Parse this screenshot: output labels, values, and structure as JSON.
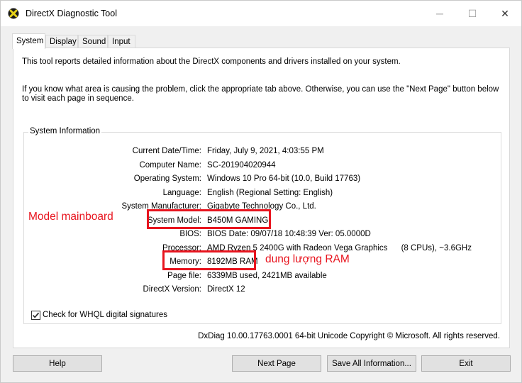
{
  "window": {
    "title": "DirectX Diagnostic Tool",
    "controls": {
      "minimize": "─",
      "maximize": "☐",
      "close": "✕"
    }
  },
  "tabs": [
    {
      "label": "System",
      "active": true
    },
    {
      "label": "Display",
      "active": false
    },
    {
      "label": "Sound",
      "active": false
    },
    {
      "label": "Input",
      "active": false
    }
  ],
  "intro": {
    "line1": "This tool reports detailed information about the DirectX components and drivers installed on your system.",
    "line2": "If you know what area is causing the problem, click the appropriate tab above.  Otherwise, you can use the \"Next Page\" button below to visit each page in sequence."
  },
  "system_info": {
    "title": "System Information",
    "rows": [
      {
        "label": "Current Date/Time:",
        "value": "Friday, July 9, 2021, 4:03:55 PM"
      },
      {
        "label": "Computer Name:",
        "value": "SC-201904020944"
      },
      {
        "label": "Operating System:",
        "value": "Windows 10 Pro 64-bit (10.0, Build 17763)"
      },
      {
        "label": "Language:",
        "value": "English (Regional Setting: English)"
      },
      {
        "label": "System Manufacturer:",
        "value": "Gigabyte Technology Co., Ltd."
      },
      {
        "label": "System Model:",
        "value": "B450M GAMING"
      },
      {
        "label": "BIOS:",
        "value": "BIOS Date: 09/07/18 10:48:39 Ver: 05.0000D"
      },
      {
        "label": "Processor:",
        "value": "AMD Ryzen 5 2400G with Radeon Vega Graphics      (8 CPUs), ~3.6GHz"
      },
      {
        "label": "Memory:",
        "value": "8192MB RAM"
      },
      {
        "label": "Page file:",
        "value": "6339MB used, 2421MB available"
      },
      {
        "label": "DirectX Version:",
        "value": "DirectX 12"
      }
    ],
    "checkbox_label": "Check for WHQL digital signatures",
    "checkbox_checked": true
  },
  "footer": "DxDiag 10.00.17763.0001 64-bit Unicode  Copyright © Microsoft. All rights reserved.",
  "annotations": {
    "mainboard": "Model mainboard",
    "ram": "dung lượng RAM",
    "color": "#e8141e"
  },
  "buttons": {
    "help": "Help",
    "next_page": "Next Page",
    "save_all": "Save All Information...",
    "exit": "Exit"
  }
}
